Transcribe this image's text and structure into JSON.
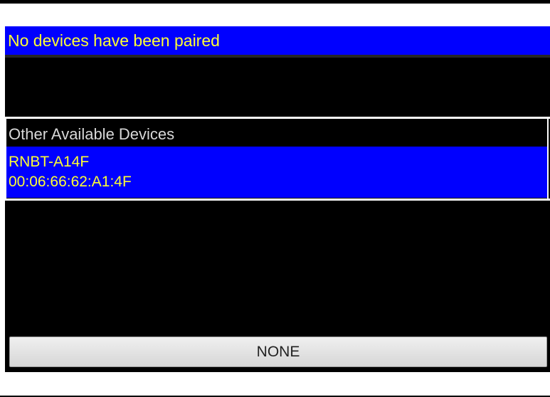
{
  "paired": {
    "header": "No devices have been paired"
  },
  "other": {
    "title": "Other Available Devices",
    "devices": [
      {
        "name": "RNBT-A14F",
        "address": "00:06:66:62:A1:4F"
      }
    ]
  },
  "action": {
    "button_label": "NONE"
  },
  "colors": {
    "list_highlight": "#0000ff",
    "highlight_text": "#ffff33",
    "background": "#000000",
    "section_label": "#d8d8d8"
  }
}
